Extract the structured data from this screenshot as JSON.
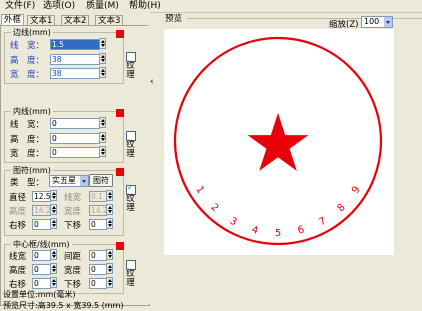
{
  "menu": [
    {
      "label": "文件(F)"
    },
    {
      "label": "选项(O)"
    },
    {
      "label": "质量(M)"
    },
    {
      "label": "帮助(H)"
    }
  ],
  "tabs": [
    "外框",
    "文本1",
    "文本2",
    "文本3"
  ],
  "outer_line": {
    "title": "边线(mm)",
    "width_label": "线　宽：",
    "width_value": "1.5",
    "height_label": "高　度：",
    "height_value": "38",
    "breadth_label": "宽　度：",
    "breadth_value": "38",
    "texture_label": "纹理"
  },
  "inner_line": {
    "title": "内线(mm)",
    "width_label": "线　宽：",
    "width_value": "0",
    "height_label": "高　度：",
    "height_value": "0",
    "breadth_label": "宽　度：",
    "breadth_value": "0",
    "texture_label": "纹理"
  },
  "symbol": {
    "title": "图符(mm)",
    "type_label": "类　型：",
    "type_value": "实五星",
    "symbol_button": "图符",
    "diameter_label": "直径",
    "diameter_value": "12.5",
    "linewidth_label": "线宽",
    "linewidth_value": "0.1",
    "height_label": "高度",
    "height_value": "14.2",
    "breadth_label": "宽度",
    "breadth_value": "14.2",
    "right_label": "右移",
    "right_value": "0",
    "down_label": "下移",
    "down_value": "0",
    "texture_label": "纹理",
    "texture_checked": true
  },
  "center": {
    "title": "中心框/线(mm)",
    "linewidth_label": "线宽",
    "linewidth_value": "0",
    "spacing_label": "间距",
    "spacing_value": "0",
    "height_label": "高度",
    "height_value": "0",
    "breadth_label": "宽度",
    "breadth_value": "0",
    "right_label": "右移",
    "right_value": "0",
    "down_label": "下移",
    "down_value": "0",
    "texture_label": "纹理"
  },
  "status": {
    "units": "设置单位:mm(毫米)",
    "size": "预览尺寸:高39.5 x 宽39.5 (mm)"
  },
  "collapse_glyph": "‹",
  "preview": {
    "title": "预览",
    "zoom_label": "缩放(Z)",
    "zoom_value": "100",
    "digits": [
      "1",
      "2",
      "3",
      "4",
      "5",
      "6",
      "7",
      "8",
      "9"
    ],
    "stamp_color": "#e8000b"
  }
}
